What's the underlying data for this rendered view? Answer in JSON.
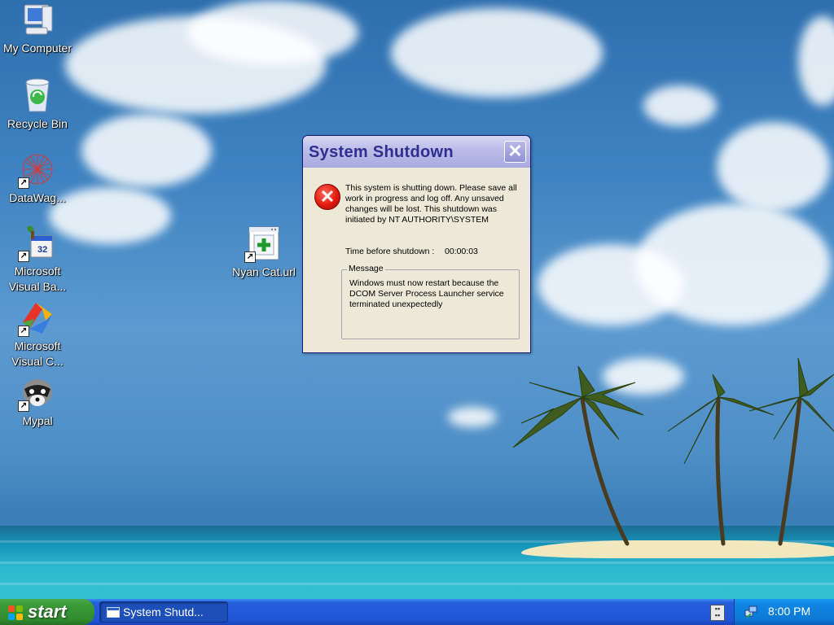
{
  "desktop": {
    "icons": [
      {
        "label": "My Computer",
        "icon": "my-computer-icon"
      },
      {
        "label": "Recycle Bin",
        "icon": "recycle-bin-icon"
      },
      {
        "label": "DataWag...",
        "icon": "datawag-icon"
      },
      {
        "label": "Microsoft Visual Ba...",
        "icon": "visual-basic-icon"
      },
      {
        "label": "Microsoft Visual C...",
        "icon": "visual-c-icon"
      },
      {
        "label": "Mypal",
        "icon": "mypal-icon"
      },
      {
        "label": "Nyan Cat.url",
        "icon": "url-shortcut-icon"
      }
    ]
  },
  "dialog": {
    "title": "System Shutdown",
    "message": "This system is shutting down. Please save all work in progress and log off. Any unsaved changes will be lost. This shutdown was initiated by NT AUTHORITY\\SYSTEM",
    "countdown_label": "Time before shutdown :",
    "countdown_value": "00:00:03",
    "group_label": "Message",
    "group_message": "Windows must now restart because the DCOM Server Process Launcher service terminated unexpectedly",
    "icon": "error-icon"
  },
  "taskbar": {
    "start_label": "start",
    "task_button_label": "System Shutd...",
    "clock": "8:00 PM"
  },
  "colors": {
    "title_text": "#2f2f8f",
    "taskbar_blue": "#245edc",
    "start_green": "#3c9c39",
    "dialog_bg": "#ece9d8"
  }
}
